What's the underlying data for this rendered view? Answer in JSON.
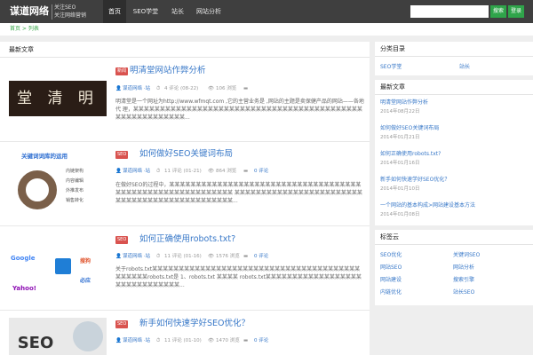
{
  "header": {
    "logo": "谋道网络",
    "slogan_line1": "关注SEO",
    "slogan_line2": "关注网络营销",
    "nav": [
      "首页",
      "SEO学堂",
      "站长",
      "网站分析"
    ],
    "search": {
      "value": "",
      "placeholder": ""
    },
    "search_button": "搜索",
    "login_button": "登录"
  },
  "breadcrumb": "首页 > 列表",
  "main": {
    "title": "最新文章",
    "posts": [
      {
        "tag": "新闻",
        "title": "明清堂网站作弊分析",
        "author": "谋道网络 ·站",
        "comments": "4 评论 (08-22)",
        "views": "106 浏览",
        "excerpt": "明清堂是一个网址为http://www.wfmqt.com ,它的主营业务是 ,网站的主题是卖保健产品的网站——各地代 理，某某某某某某某某某某某某某某某某某某某某某某某某某某某某某某某某某某某某某某某某某某某某某某某某某某某某某某某某...",
        "thumb_text": "堂 清 明"
      },
      {
        "tag": "SEO",
        "title": "如何做好SEO关键词布局",
        "author": "谋道网络 ·站",
        "comments": "11 评论 (01-21)",
        "views": "864 浏览",
        "extra": "0 评论",
        "excerpt": "在做好SEO的过程中，某某某某某某某某某某某某某某某某某某某某某某某某某某某某某某某某某某某某某某某某某某某某某某某某某某某某某某某某某某 某某某某某某某某某某某某某某某某某某某某某某某某某某某某某某某某某某某某某某某某某某某某某某...",
        "thumb_title": "关键词词库的运用",
        "thumb_labels": [
          "内链架构",
          "内容编辑",
          "外推发布",
          "销售转化"
        ]
      },
      {
        "tag": "SEO",
        "title": "如何正确使用robots.txt?",
        "author": "谋道网络 ·站",
        "comments": "11 评论 (01-16)",
        "views": "1576 浏览",
        "extra": "0 评论",
        "excerpt": "关于robots.txt某某某某某某某某某某某某某某某某某某某某某某某某某某某某某某某某某某某某某某某某某某某某某robots.txt是 1、robots.txt 某某某某 robots.txt某某某某某某某某某某某某某某某某某某某某某某某某某某某某某某...",
        "thumb_labels": [
          "Google",
          "Yahoo!",
          "必应",
          "搜狗"
        ]
      },
      {
        "tag": "SEO",
        "title": "新手如何快速学好SEO优化？",
        "author": "谋道网络 ·站",
        "comments": "11 评论 (01-10)",
        "views": "1470 浏览",
        "extra": "0 评论",
        "thumb_text": "SEO"
      }
    ]
  },
  "sidebar": {
    "categories": {
      "title": "分类目录",
      "items": [
        "SEO学堂",
        "站长"
      ]
    },
    "recent": {
      "title": "最新文章",
      "items": [
        {
          "title": "明清堂网站作弊分析",
          "date": "2014年08月22日"
        },
        {
          "title": "如何做好SEO关键词布局",
          "date": "2014年01月21日"
        },
        {
          "title": "如何正确使用robots.txt?",
          "date": "2014年01月16日"
        },
        {
          "title": "新手如何快速学好SEO优化？",
          "date": "2014年01月10日"
        },
        {
          "title": "一个网站的基本构成>网站建设基本方法",
          "date": "2014年01月08日"
        }
      ]
    },
    "tags": {
      "title": "标签云",
      "items": [
        "SEO优化",
        "关键词SEO",
        "网站SEO",
        "网站分析",
        "网站建设",
        "搜索引擎",
        "内链优化",
        "站长SEO"
      ]
    }
  },
  "colors": {
    "topbar": "#3f3f3f",
    "link": "#3878c8",
    "tag": "#d9534f",
    "button": "#2fa44a"
  }
}
